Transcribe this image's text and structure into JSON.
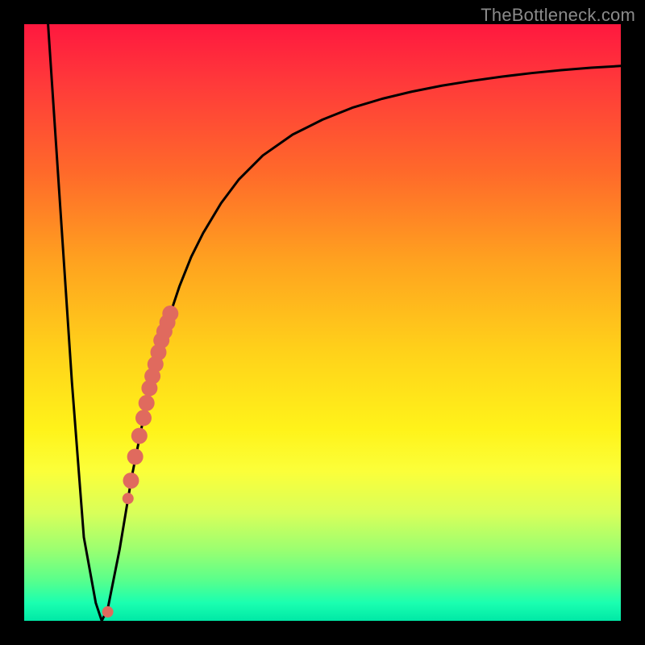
{
  "watermark": "TheBottleneck.com",
  "chart_data": {
    "type": "line",
    "title": "",
    "xlabel": "",
    "ylabel": "",
    "xlim": [
      0,
      100
    ],
    "ylim": [
      0,
      100
    ],
    "grid": false,
    "legend": false,
    "series": [
      {
        "name": "curve",
        "x": [
          4,
          6,
          8,
          10,
          12,
          13,
          14,
          16,
          18,
          20,
          22,
          24,
          26,
          28,
          30,
          33,
          36,
          40,
          45,
          50,
          55,
          60,
          65,
          70,
          75,
          80,
          85,
          90,
          95,
          100
        ],
        "y": [
          100,
          70,
          40,
          14,
          3,
          0,
          2,
          12,
          24,
          34,
          43,
          50,
          56,
          61,
          65,
          70,
          74,
          78,
          81.5,
          84,
          86,
          87.5,
          88.7,
          89.7,
          90.5,
          91.2,
          91.8,
          92.3,
          92.7,
          93
        ]
      },
      {
        "name": "highlight-points",
        "x": [
          14.0,
          17.4,
          17.9,
          18.6,
          19.3,
          20.0,
          20.5,
          21.0,
          21.5,
          22.0,
          22.5,
          23.0,
          23.5,
          24.0,
          24.5
        ],
        "y": [
          1.5,
          20.5,
          23.5,
          27.5,
          31.0,
          34.0,
          36.5,
          39.0,
          41.0,
          43.0,
          45.0,
          47.0,
          48.5,
          50.0,
          51.5
        ]
      }
    ]
  }
}
